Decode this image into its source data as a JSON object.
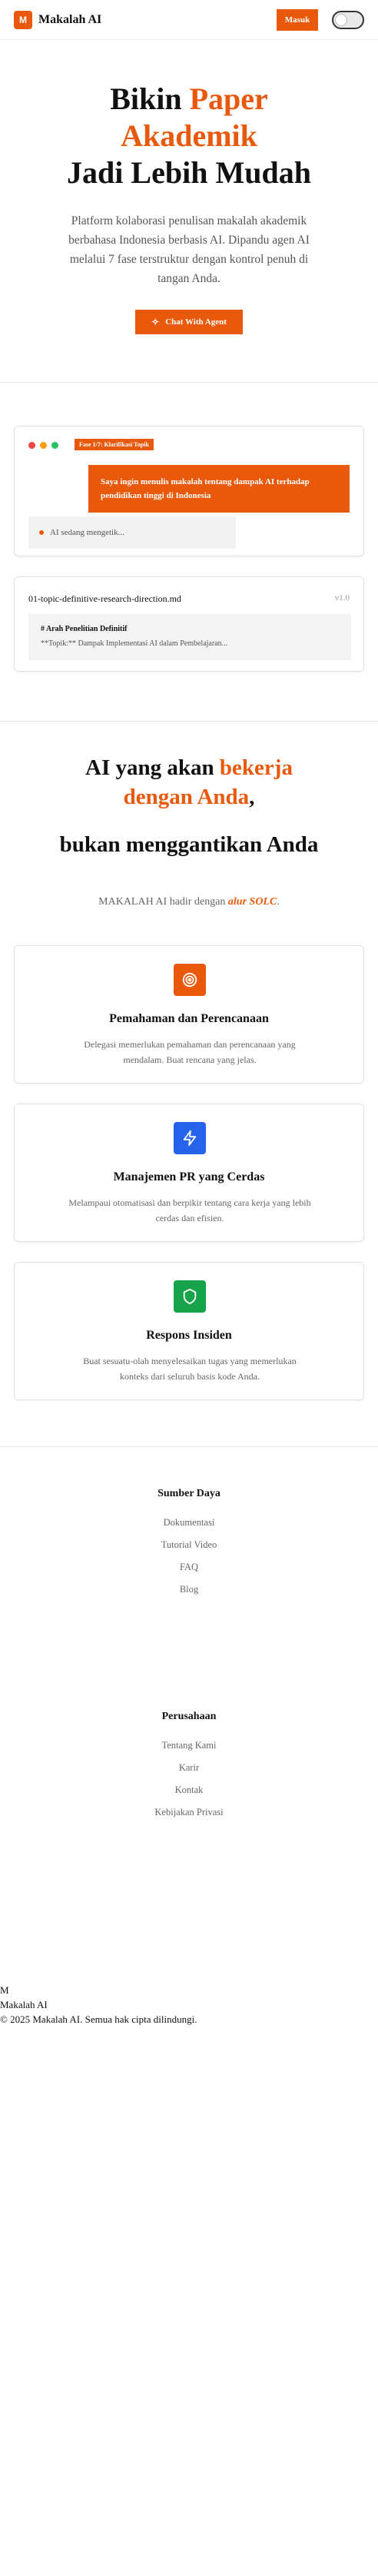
{
  "header": {
    "logo_letter": "M",
    "brand": "Makalah AI",
    "login_label": "Masuk",
    "theme_toggle": "theme-toggle"
  },
  "hero": {
    "title_line1_plain": "Bikin ",
    "title_line1_accent": "Paper",
    "title_line2_accent": "Akademik",
    "title_line3": "Jadi Lebih Mudah",
    "description": "Platform kolaborasi penulisan makalah akademik berbahasa Indonesia berbasis AI. Dipandu agen AI melalui 7 fase terstruktur dengan kontrol penuh di tangan Anda.",
    "cta_label": "Chat With Agent",
    "cta_icon": "sparkle-icon"
  },
  "demo_chat": {
    "phase_badge": "Fase 1/7: Klarifikasi Topik",
    "user_message": "Saya ingin menulis makalah tentang dampak AI terhadap pendidikan tinggi di Indonesia",
    "typing_text": "AI sedang mengetik..."
  },
  "demo_file": {
    "file_name": "01-topic-definitive-research-direction.md",
    "version": "v1.0",
    "preview_heading": "# Arah Penelitian Definitif",
    "preview_line": "**Topik:** Dampak Implementasi AI dalam Pembelajaran..."
  },
  "section2": {
    "title_plain": "AI yang akan ",
    "title_accent_1": "bekerja",
    "title_accent_2": "dengan Anda",
    "title_comma": ",",
    "title_line2": "bukan menggantikan Anda",
    "subtitle_plain": "MAKALAH AI hadir dengan ",
    "subtitle_accent": "alur SOLC",
    "subtitle_end": "."
  },
  "features": [
    {
      "title": "Pemahaman dan Perencanaan",
      "desc": "Delegasi memerlukan pemahaman dan perencanaan yang mendalam. Buat rencana yang jelas.",
      "icon": "target-icon",
      "color": "#e8590c"
    },
    {
      "title": "Manajemen PR yang Cerdas",
      "desc": "Melampaui otomatisasi dan berpikir tentang cara kerja yang lebih cerdas dan efisien.",
      "icon": "lightning-icon",
      "color": "#2563eb"
    },
    {
      "title": "Respons Insiden",
      "desc": "Buat sesuatu-olah menyelesaikan tugas yang memerlukan konteks dari seluruh basis kode Anda.",
      "icon": "shield-icon",
      "color": "#16a34a"
    }
  ],
  "footer": {
    "resources_heading": "Sumber Daya",
    "resources": [
      "Dokumentasi",
      "Tutorial Video",
      "FAQ",
      "Blog"
    ],
    "company_heading": "Perusahaan",
    "company": [
      "Tentang Kami",
      "Karir",
      "Kontak",
      "Kebijakan Privasi"
    ],
    "logo_letter": "M",
    "brand": "Makalah AI",
    "copyright": "© 2025 Makalah AI. Semua hak cipta dilindungi."
  }
}
